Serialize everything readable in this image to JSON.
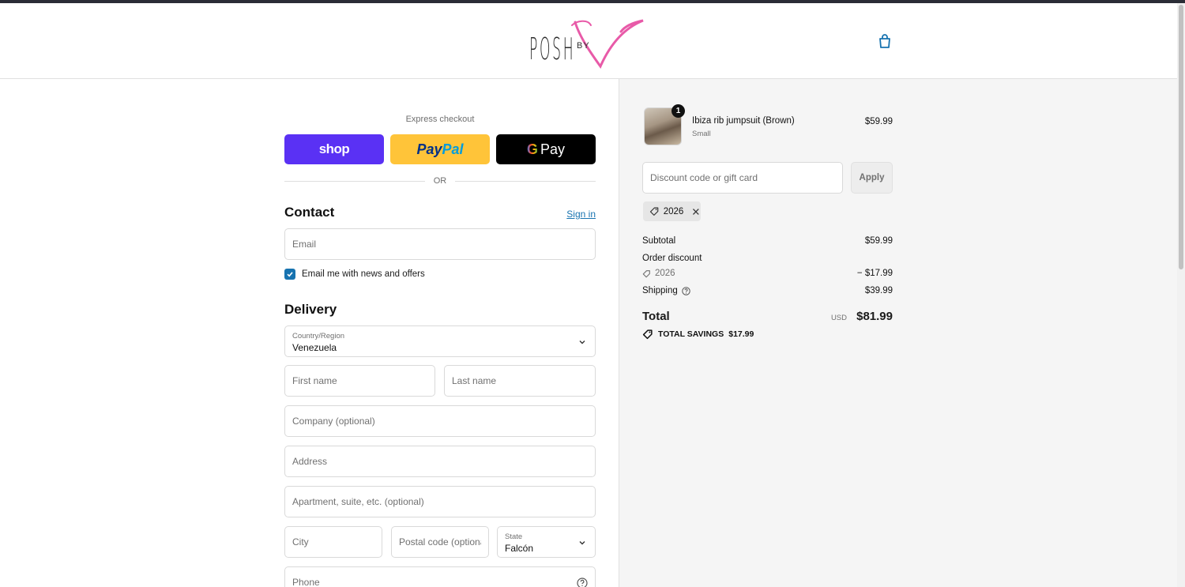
{
  "brand": {
    "logo_text": "POSH",
    "logo_by": "BY"
  },
  "express": {
    "label": "Express checkout",
    "shop_label": "shop",
    "paypal_label_1": "Pay",
    "paypal_label_2": "Pal",
    "gpay_g": "G",
    "gpay_label": "Pay",
    "or_text": "OR"
  },
  "contact": {
    "title": "Contact",
    "signin_label": "Sign in",
    "email_placeholder": "Email",
    "newsletter_label": "Email me with news and offers",
    "newsletter_checked": true
  },
  "delivery": {
    "title": "Delivery",
    "country_label": "Country/Region",
    "country_value": "Venezuela",
    "first_name_placeholder": "First name",
    "last_name_placeholder": "Last name",
    "company_placeholder": "Company (optional)",
    "address_placeholder": "Address",
    "apartment_placeholder": "Apartment, suite, etc. (optional)",
    "city_placeholder": "City",
    "postal_placeholder": "Postal code (optional)",
    "state_label": "State",
    "state_value": "Falcón",
    "phone_placeholder": "Phone"
  },
  "summary": {
    "item": {
      "name": "Ibiza rib jumpsuit (Brown)",
      "variant": "Small",
      "price": "$59.99",
      "quantity": "1"
    },
    "discount_placeholder": "Discount code or gift card",
    "apply_label": "Apply",
    "applied_code": "2026",
    "subtotal_label": "Subtotal",
    "subtotal_value": "$59.99",
    "order_discount_label": "Order discount",
    "discount_code": "2026",
    "discount_value": "− $17.99",
    "shipping_label": "Shipping",
    "shipping_value": "$39.99",
    "total_label": "Total",
    "currency": "USD",
    "total_value": "$81.99",
    "savings_label": "TOTAL SAVINGS",
    "savings_value": "$17.99"
  },
  "colors": {
    "shop": "#5a31f4",
    "paypal": "#ffc439",
    "gpay": "#000000",
    "link": "#1773b0",
    "logo_accent": "#e85aa8"
  }
}
